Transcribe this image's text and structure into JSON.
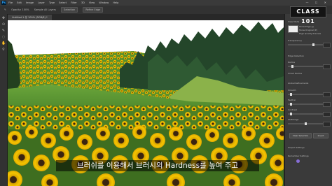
{
  "app": {
    "menu": [
      "File",
      "Edit",
      "Image",
      "Layer",
      "Type",
      "Select",
      "Filter",
      "3D",
      "View",
      "Window",
      "Help"
    ],
    "options_bar": {
      "opacity_label": "Opacity: 100%",
      "sample_label": "Sample All Layers",
      "button_1": "Selection",
      "button_2": "Refine Edge"
    },
    "window_controls": "— ☐ ✕"
  },
  "document": {
    "tab_title": "Untitled-1 @ 100% (RGB/8) *"
  },
  "panel": {
    "view_mode_label": "View Mode",
    "view_opts": [
      "Show Edge (J)",
      "Show Original (P)",
      "High Quality Preview"
    ],
    "transparency_label": "Transparency",
    "edge_detection_label": "Edge Detection",
    "radius_label": "Radius",
    "smart_radius_label": "Smart Radius",
    "global_refinements_label": "Global Refinements",
    "smooth_label": "Smooth",
    "feather_label": "Feather",
    "contrast_label": "Contrast",
    "shift_edge_label": "Shift Edge",
    "clear_selection_label": "Clear Selection",
    "invert_label": "Invert",
    "output_settings_label": "Output Settings",
    "remember_label": "Remember Settings"
  },
  "brand": {
    "logo_text": "CLASS 101"
  },
  "caption": {
    "text": "브러쉬를 이용해서 브러시의 Hardness를 높여 주고"
  },
  "colors": {
    "sky": "#ffffff",
    "grass": "#4e8a2e",
    "tree_dark": "#1f3d1e",
    "sunflower_petal": "#f2c200",
    "sunflower_center": "#3a2410"
  }
}
